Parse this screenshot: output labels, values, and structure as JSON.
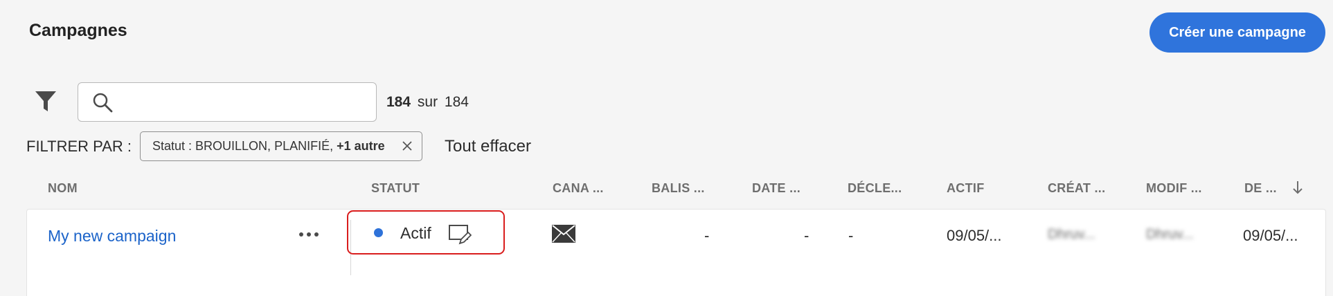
{
  "header": {
    "title": "Campagnes",
    "create_button": "Créer une campagne"
  },
  "search": {
    "value": "",
    "placeholder": ""
  },
  "count": {
    "shown": "184",
    "separator": "sur",
    "total": "184"
  },
  "filters": {
    "label": "FILTRER PAR :",
    "tag_text": "Statut : BROUILLON, PLANIFIÉ,",
    "tag_more": "+1 autre",
    "clear_all": "Tout effacer"
  },
  "table": {
    "columns": [
      "NOM",
      "STATUT",
      "CANA ...",
      "BALIS ...",
      "DATE ...",
      "DÉCLE...",
      "ACTIF",
      "CRÉAT ...",
      "MODIF ...",
      "DE ..."
    ],
    "sort_column": "DE ...",
    "sort_direction": "descending",
    "rows": [
      {
        "name": "My new campaign",
        "status": "Actif",
        "status_color": "#2e72d9",
        "channel_icon": "email-icon",
        "tags": "-",
        "date": "-",
        "trigger": "-",
        "active": "09/05/...",
        "created_by": "Dhruv...",
        "modified_by": "Dhruv...",
        "from": "09/05/..."
      }
    ]
  },
  "colors": {
    "accent": "#2f74dc",
    "link": "#1b63c9",
    "highlight": "#d91c1c",
    "background": "#f5f5f5"
  }
}
